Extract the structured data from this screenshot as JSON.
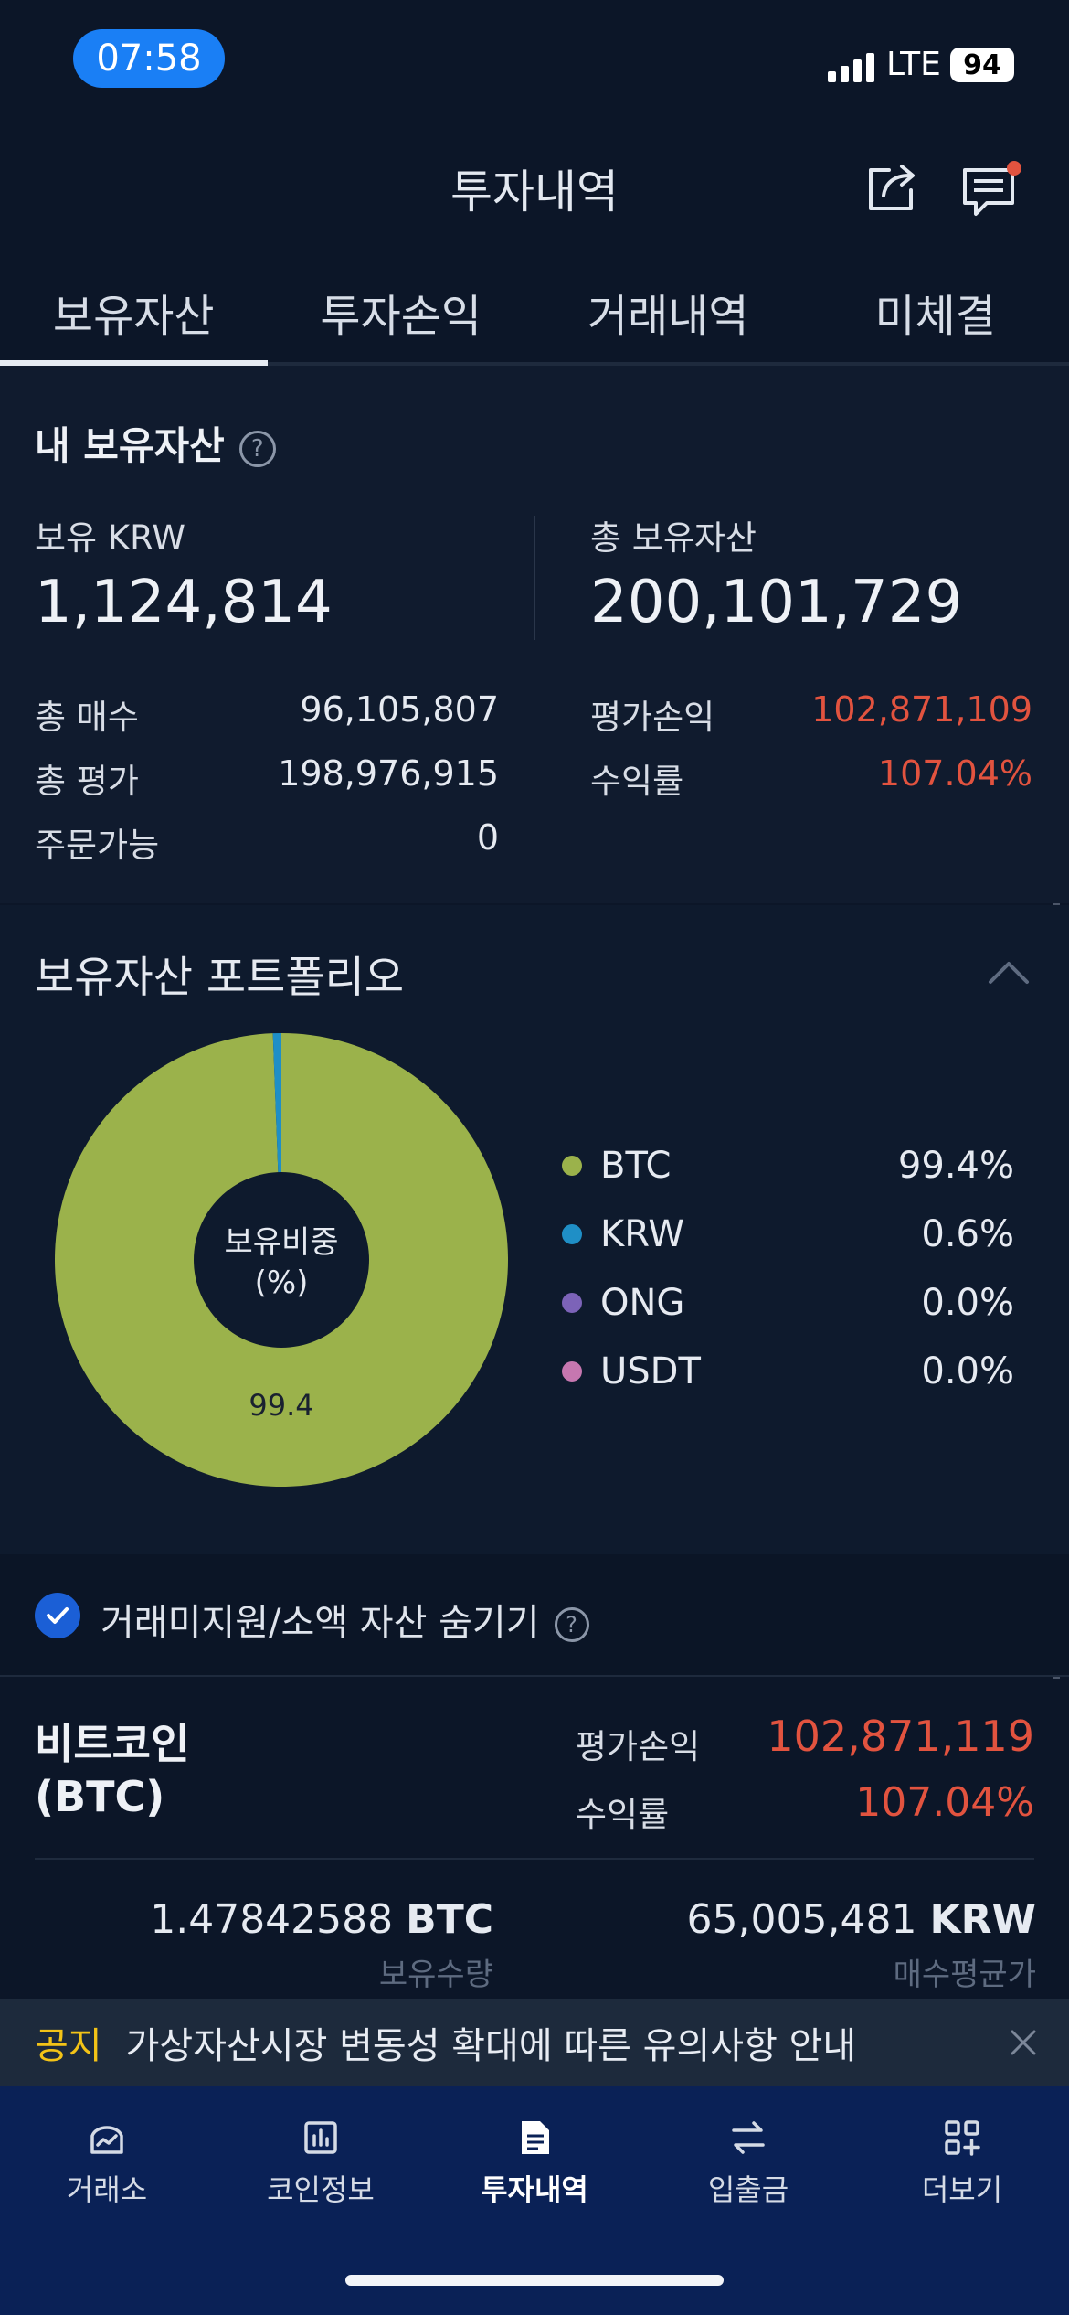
{
  "status_bar": {
    "time": "07:58",
    "network": "LTE",
    "battery": "94"
  },
  "header": {
    "title": "투자내역"
  },
  "tabs": [
    {
      "label": "보유자산",
      "active": true
    },
    {
      "label": "투자손익"
    },
    {
      "label": "거래내역"
    },
    {
      "label": "미체결"
    }
  ],
  "summary": {
    "heading": "내 보유자산",
    "help": "?",
    "krw_label": "보유 KRW",
    "krw_value": "1,124,814",
    "total_label": "총 보유자산",
    "total_value": "200,101,729",
    "buy_label": "총 매수",
    "buy_value": "96,105,807",
    "eval_label": "총 평가",
    "eval_value": "198,976,915",
    "orderable_label": "주문가능",
    "orderable_value": "0",
    "pnl_label": "평가손익",
    "pnl_value": "102,871,109",
    "rate_label": "수익률",
    "rate_value": "107.04%"
  },
  "portfolio": {
    "title": "보유자산 포트폴리오",
    "center_label_1": "보유비중",
    "center_label_2": "(%)",
    "slice_label": "99.4",
    "legend": [
      {
        "name": "BTC",
        "pct": "99.4%",
        "color": "#9bb24b"
      },
      {
        "name": "KRW",
        "pct": "0.6%",
        "color": "#1f8fc6"
      },
      {
        "name": "ONG",
        "pct": "0.0%",
        "color": "#7c63b8"
      },
      {
        "name": "USDT",
        "pct": "0.0%",
        "color": "#c677b0"
      }
    ]
  },
  "chart_data": {
    "type": "pie",
    "categories": [
      "BTC",
      "KRW",
      "ONG",
      "USDT"
    ],
    "values": [
      99.4,
      0.6,
      0.0,
      0.0
    ]
  },
  "hide_small": {
    "label": "거래미지원/소액 자산 숨기기",
    "checked": true,
    "help": "?"
  },
  "holding": {
    "name_line1": "비트코인",
    "name_line2": "(BTC)",
    "pnl_label": "평가손익",
    "pnl_value": "102,871,119",
    "rate_label": "수익률",
    "rate_value": "107.04%",
    "qty_value": "1.47842588",
    "qty_unit": "BTC",
    "qty_label": "보유수량",
    "avg_value": "65,005,481",
    "avg_unit": "KRW",
    "avg_label": "매수평균가"
  },
  "notice": {
    "tag": "공지",
    "text": "가상자산시장 변동성 확대에 따른 유의사항 안내"
  },
  "bottom_nav": [
    {
      "label": "거래소",
      "icon": "exchange-icon"
    },
    {
      "label": "코인정보",
      "icon": "chart-icon"
    },
    {
      "label": "투자내역",
      "icon": "document-icon",
      "active": true
    },
    {
      "label": "입출금",
      "icon": "transfer-icon"
    },
    {
      "label": "더보기",
      "icon": "more-icon"
    }
  ]
}
